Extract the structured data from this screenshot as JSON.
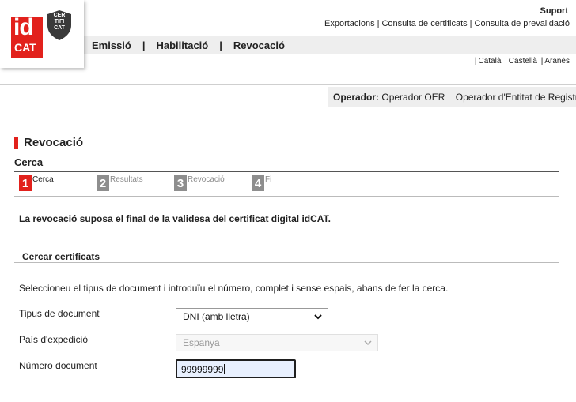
{
  "logo": {
    "id_text": "id",
    "cat_text": "CAT",
    "shield_lines": [
      "CER",
      "TIFI",
      "CAT"
    ]
  },
  "header": {
    "suport": "Suport",
    "links": [
      "Exportacions",
      "Consulta de certificats",
      "Consulta de prevalidació"
    ],
    "separator": "|"
  },
  "nav": {
    "items": [
      "Emissió",
      "Habilitació",
      "Revocació"
    ],
    "separator": "|"
  },
  "languages": {
    "items": [
      "Català",
      "Castellà",
      "Aranès"
    ],
    "separator": "|"
  },
  "operator": {
    "label": "Operador:",
    "name": "Operador OER",
    "role": "Operador d'Entitat de Registre"
  },
  "page": {
    "title": "Revocació",
    "subtitle": "Cerca"
  },
  "steps": [
    {
      "num": "1",
      "label": "Cerca",
      "active": true
    },
    {
      "num": "2",
      "label": "Resultats",
      "active": false
    },
    {
      "num": "3",
      "label": "Revocació",
      "active": false
    },
    {
      "num": "4",
      "label": "Fi",
      "active": false
    }
  ],
  "notice": "La revocació suposa el final de la validesa del certificat digital idCAT.",
  "search": {
    "title": "Cercar certificats",
    "instructions": "Seleccioneu el tipus de document i introduïu el número, complet i sense espais, abans de fer la cerca."
  },
  "form": {
    "doc_type_label": "Tipus de document",
    "doc_type_value": "DNI (amb lletra)",
    "country_label": "País d'expedició",
    "country_value": "Espanya",
    "doc_number_label": "Número document",
    "doc_number_value": "99999999"
  },
  "colors": {
    "accent": "#e2211c",
    "step_inactive": "#8e8e8e"
  },
  "icons": {
    "dropdown": "chevron-down-icon"
  }
}
